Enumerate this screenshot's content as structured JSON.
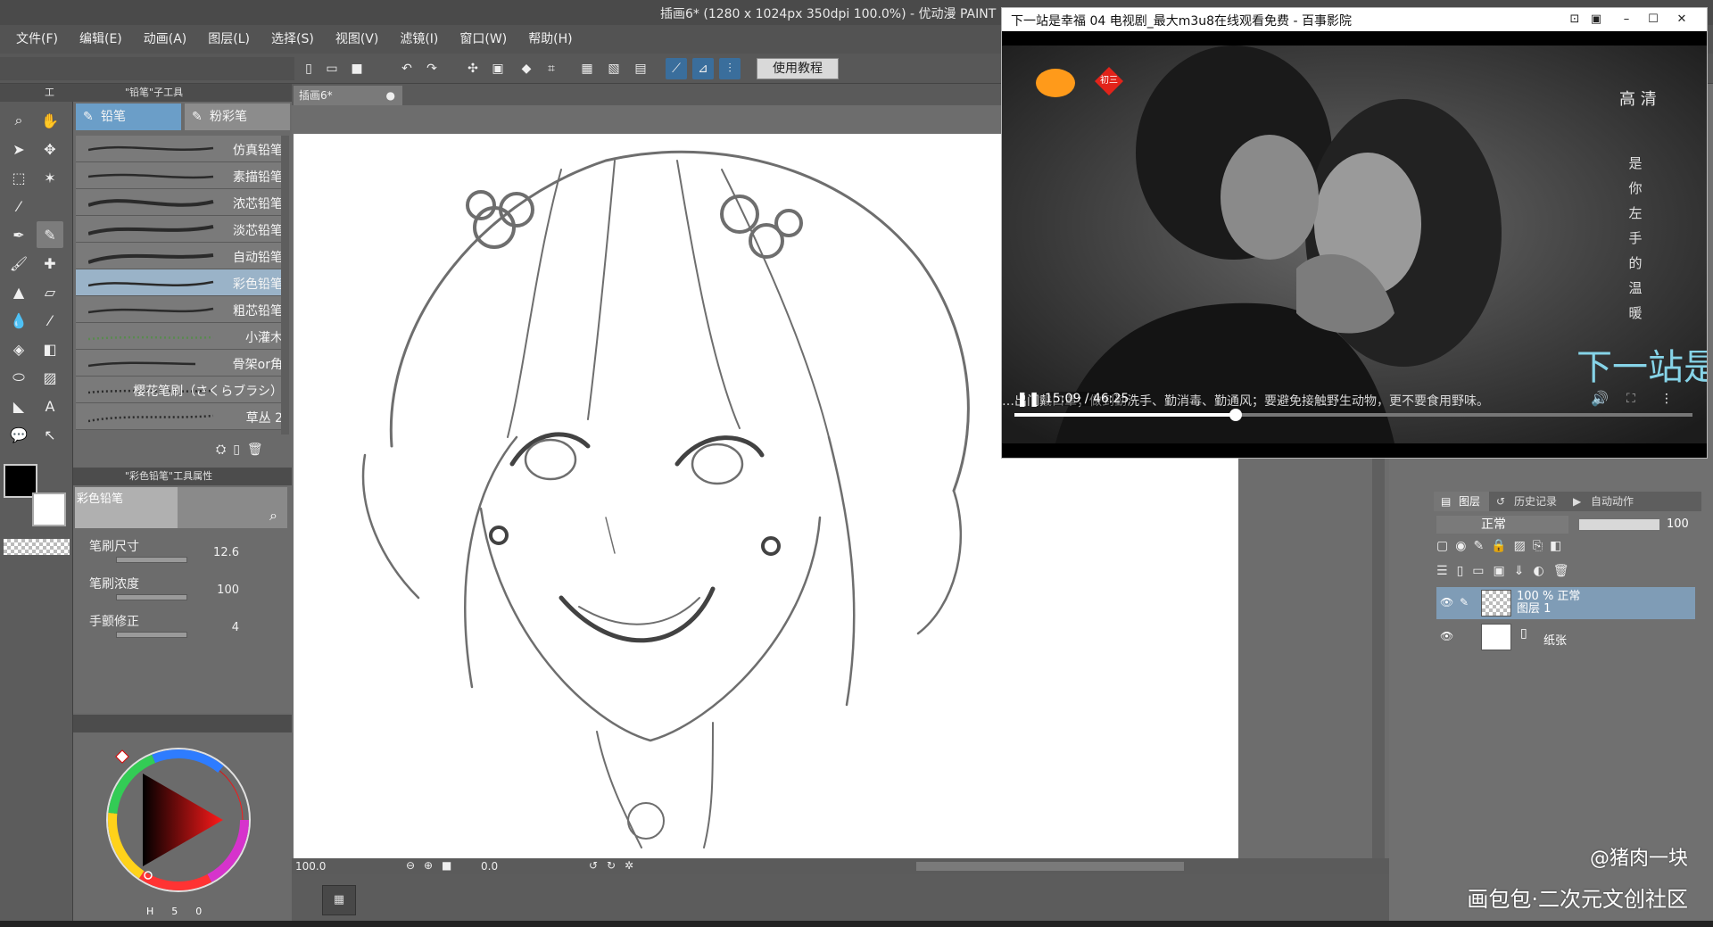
{
  "app": {
    "title": "插画6* (1280 x 1024px 350dpi 100.0%) - 优动漫 PAINT"
  },
  "menu": {
    "items": [
      "文件(F)",
      "编辑(E)",
      "动画(A)",
      "图层(L)",
      "选择(S)",
      "视图(V)",
      "滤镜(I)",
      "窗口(W)",
      "帮助(H)"
    ]
  },
  "toolbar": {
    "tutorial_label": "使用教程"
  },
  "tool_column": {
    "header_label": "工"
  },
  "subtool": {
    "header": "\"铅笔\"子工具",
    "tabs": [
      "铅笔",
      "粉彩笔"
    ],
    "brushes": [
      "仿真铅笔",
      "素描铅笔",
      "浓芯铅笔",
      "淡芯铅笔",
      "自动铅笔",
      "彩色铅笔",
      "粗芯铅笔",
      "小灌木",
      "骨架or角",
      "樱花笔刷（さくらブラシ）",
      "草丛 2"
    ],
    "active_brush": "彩色铅笔"
  },
  "tool_property": {
    "header": "\"彩色铅笔\"工具属性",
    "preview_label": "彩色铅笔",
    "rows": [
      {
        "label": "笔刷尺寸",
        "value": "12.6"
      },
      {
        "label": "笔刷浓度",
        "value": "100"
      },
      {
        "label": "手颤修正",
        "value": "4"
      }
    ]
  },
  "color_panel": {
    "readout_h": "H",
    "readout_s": "5",
    "readout_v": "0"
  },
  "document": {
    "tab_label": "插画6*",
    "zoom_value": "100.0",
    "angle_value": "0.0"
  },
  "layers": {
    "tabs": [
      "图层",
      "历史记录",
      "自动动作"
    ],
    "blend_mode": "正常",
    "opacity": "100",
    "items": [
      {
        "line1": "100 % 正常",
        "line2": "图层 1"
      },
      {
        "line1": "纸张",
        "line2": ""
      }
    ]
  },
  "video": {
    "window_title": "下一站是幸福 04 电视剧_最大m3u8在线观看免费 - 百事影院",
    "current_time": "15:09",
    "duration": "46:25",
    "time_display": "15:09 / 46:25",
    "progress": 0.326,
    "subtitle": "…出门戴口罩；做到勤洗手、勤消毒、勤通风；要避免接触野生动物，更不要食用野味。",
    "quality_badge": "高 清",
    "vertical_text": "是你左手的温暖",
    "channel_badge": "初三",
    "show_logo": "下一站是幸福"
  },
  "watermark": {
    "author": "@猪肉一块",
    "site": "画包包·二次元文创社区"
  },
  "colors": {
    "accent_blue": "#6b9ec8",
    "panel_bg": "#6b6b6b",
    "canvas_paper": "#ffffff"
  }
}
